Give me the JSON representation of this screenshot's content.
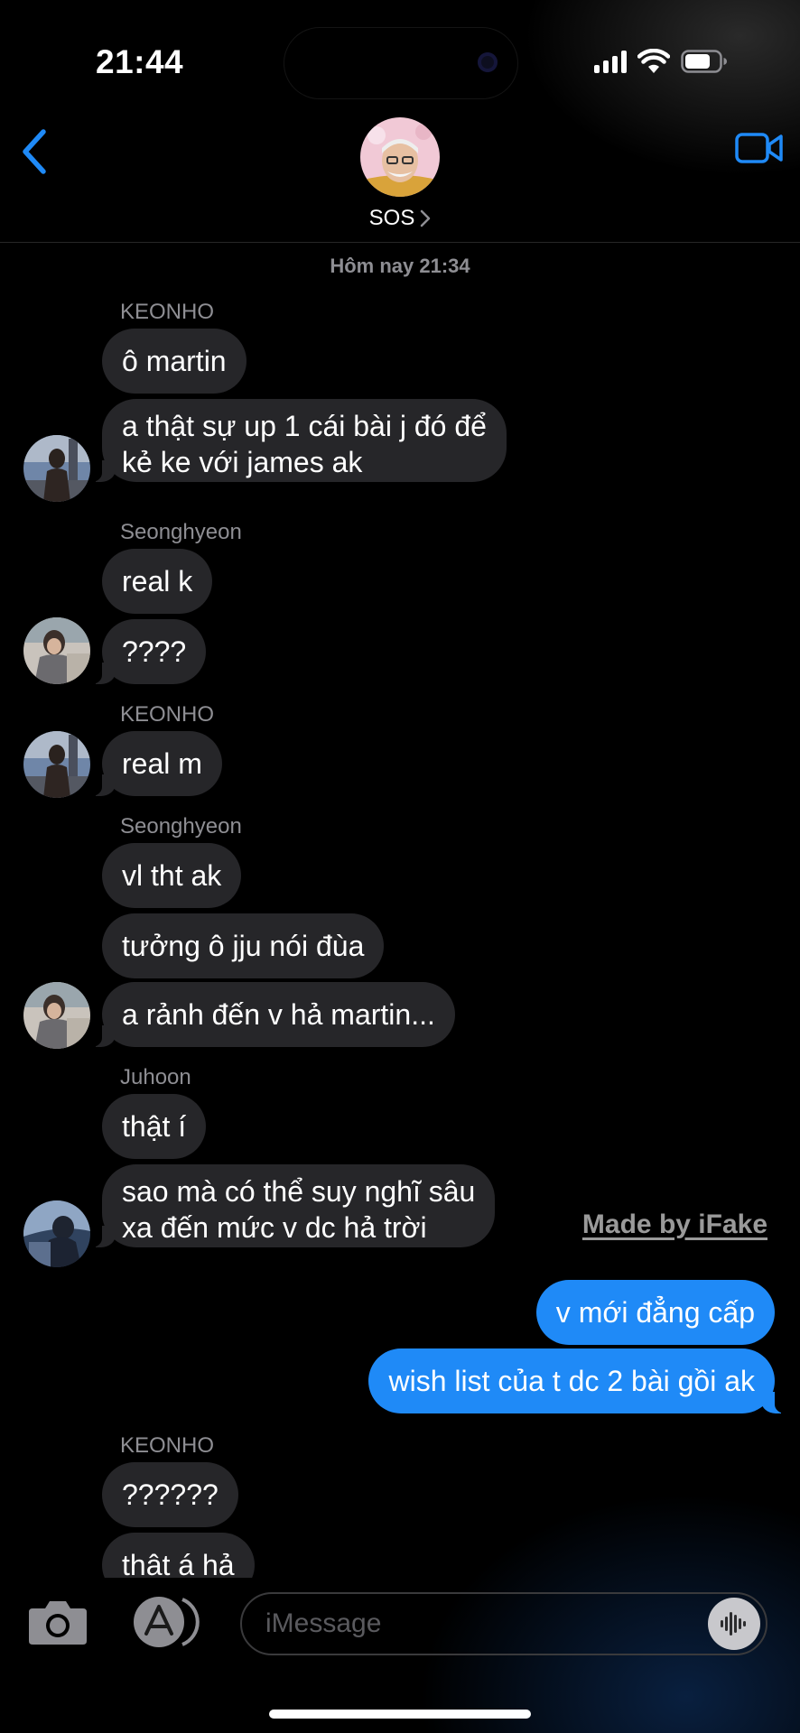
{
  "status_bar": {
    "time": "21:44",
    "signal_icon": "cellular-signal-icon",
    "wifi_icon": "wifi-icon",
    "battery_icon": "battery-icon"
  },
  "header": {
    "back_icon": "chevron-left-icon",
    "video_icon": "video-camera-icon",
    "contact_name": "SOS",
    "contact_chevron_icon": "chevron-right-icon",
    "accent_color": "#1f8af7"
  },
  "chat": {
    "timestamp": "Hôm nay 21:34",
    "senders": {
      "keonho_1": "KEONHO",
      "seonghyeon_1": "Seonghyeon",
      "keonho_2": "KEONHO",
      "seonghyeon_2": "Seonghyeon",
      "juhoon": "Juhoon",
      "keonho_3": "KEONHO"
    },
    "messages": [
      {
        "text": "ô martin"
      },
      {
        "text": "a thật sự up 1 cái bài j đó để",
        "text2": "kẻ ke với james ak"
      },
      {
        "text": "real k"
      },
      {
        "text": "????"
      },
      {
        "text": "real m"
      },
      {
        "text": "vl tht ak"
      },
      {
        "text": "tưởng ô jju nói đùa"
      },
      {
        "text": "a rảnh đến v hả martin..."
      },
      {
        "text": "thật í"
      },
      {
        "text": "sao mà có thể suy nghĩ sâu",
        "text2": "xa đến mức v dc hả trời"
      },
      {
        "text": "v mới đẳng cấp"
      },
      {
        "text": "wish list của t dc 2 bài gồi ak"
      },
      {
        "text": "??????"
      },
      {
        "text": "thât á hả"
      }
    ],
    "incoming_bubble_color": "#262629",
    "outgoing_bubble_color": "#1f8af7"
  },
  "watermark": "Made by iFake",
  "input_bar": {
    "camera_icon": "camera-icon",
    "apps_icon": "app-store-icon",
    "placeholder": "iMessage",
    "audio_icon": "waveform-icon"
  }
}
